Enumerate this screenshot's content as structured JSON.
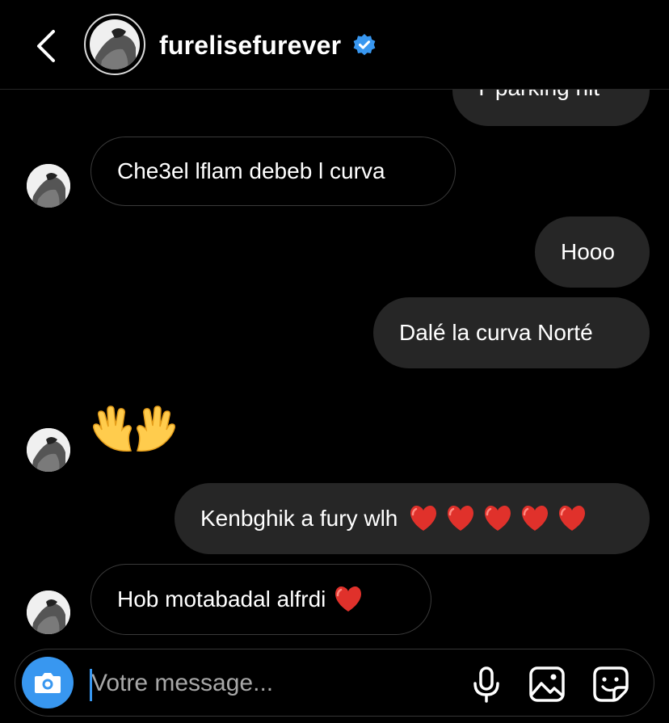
{
  "header": {
    "username": "furelisefurever",
    "verified": true
  },
  "messages": [
    {
      "side": "outgoing",
      "text": "I' parking hit"
    },
    {
      "side": "incoming",
      "text": "Che3el lflam debeb l curva"
    },
    {
      "side": "outgoing",
      "text": "Hooo"
    },
    {
      "side": "outgoing",
      "text": "Dalé la curva Norté"
    },
    {
      "side": "incoming",
      "emoji": "waving-hands",
      "text": ""
    },
    {
      "side": "outgoing",
      "text": "Kenbghik a fury wlh",
      "hearts": 5
    },
    {
      "side": "incoming",
      "text": "Hob motabadal alfrdi",
      "hearts": 1
    }
  ],
  "composer": {
    "placeholder": "Votre message..."
  },
  "colors": {
    "background": "#000000",
    "outgoing_bubble": "#262626",
    "accent_blue": "#3897f0",
    "heart_red": "#e0312b"
  },
  "icons": [
    "back-chevron",
    "verified-badge",
    "camera",
    "microphone",
    "gallery",
    "sticker"
  ]
}
